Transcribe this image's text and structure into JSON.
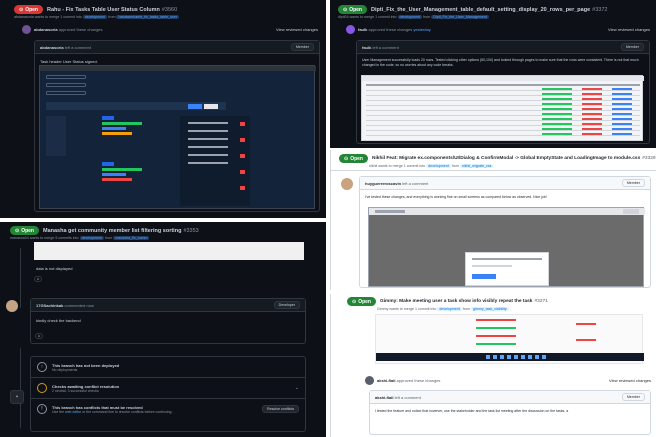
{
  "panel1": {
    "badge": "Open",
    "title": "Rahu - Fix Tasks Table User Status Column",
    "pr_number": "#3560",
    "subtitle": "abdanasoria wants to merge 1 commit into",
    "base_branch": "development",
    "head_branch": "hartawenhanfe_fix_tasks_table_user",
    "reviewer": "abdanasoria",
    "review_action": "approved these changes",
    "view_reviewed": "View reviewed changes",
    "commenter": "abdanasoria",
    "comment_time": "left a comment",
    "comment_role": "Member",
    "comment_text": "Task header User Status signed.",
    "ss_labels": [
      "Select Users",
      "Select Teams",
      "Select Project",
      "Task Header",
      "Status"
    ]
  },
  "panel2": {
    "badge": "Open",
    "title": "Dipti_Fix_the_User_Management_table_default_setting_display_20_rows_per_page",
    "pr_number": "#3372",
    "subtitle": "dipti04 wants to merge 1 commit into",
    "base_branch": "development",
    "head_branch": "Dipti_Fix_the_User_Management",
    "reviewer": "faulk",
    "review_action": "approved these changes",
    "review_time": "yesterday",
    "view_reviewed": "View reviewed changes",
    "commenter": "faulk",
    "comment_time": "left a comment",
    "comment_role": "Member",
    "comment_text": "User Management successfully loads 20 rows. Tested clicking other options (50,100) and looked through pages to make sure that the rows were consistent. There is not that much changed in the code, so no worries about any code breaks."
  },
  "panel3": {
    "badge": "Open",
    "title": "Manasha get community member list filtering sorting",
    "pr_number": "#3353",
    "subtitle": "manasha04 wants to merge 5 commits into",
    "base_branch": "development",
    "head_branch": "manasha_fix_comm",
    "line1": "data is not displayed",
    "commenter": "17GSachinkak",
    "comment_time": "commented now",
    "comment_role": "Developer",
    "comment_text": "kindly check the backend",
    "deploy_title": "This branch has not been deployed",
    "deploy_sub": "No deployments",
    "checks_title": "Checks awaiting conflict resolution",
    "checks_sub": "2 neutral, 3 successful checks",
    "conflict_title": "This branch has conflicts that must be resolved",
    "conflict_sub_pre": "Use the",
    "conflict_web_editor": "web editor",
    "conflict_sub_post": "or the command line to resolve conflicts before continuing.",
    "resolve_button": "Resolve conflicts"
  },
  "panel4": {
    "badge": "Open",
    "title": "Nikhil Feat: Migrate ex.components/UI/Dialog & ConfirmModal -> Global EmptyState and LoadingImage to module.css",
    "pr_number": "#3329",
    "subtitle": "nikhil wants to merge 1 commit into",
    "base_branch": "development",
    "head_branch": "nikhil_migrate_css",
    "commenter": "huyguerreroscavin",
    "comment_time": "left a comment",
    "comment_role": "Member",
    "comment_text": "I've tested these changes, and everything is working fine on small screens as compared below as observed. Nice job!"
  },
  "panel5": {
    "badge": "Open",
    "title": "Gimmy: Make meeting user a task show info visibly repeat the task",
    "pr_number": "#3271",
    "subtitle": "Gimmy wants to merge 1 commit into",
    "base_branch": "development",
    "head_branch": "gimmy_task_visibility",
    "reviewer": "akshi-fiali",
    "review_action": "approved these changes",
    "view_reviewed": "View reviewed changes",
    "commenter": "akshi-fiali",
    "comment_time": "left a comment",
    "comment_role": "Member",
    "comment_text": "I tested the feature and notice that however, use the stakeholder and the task list meeting after the discussion on the tasks, a"
  }
}
